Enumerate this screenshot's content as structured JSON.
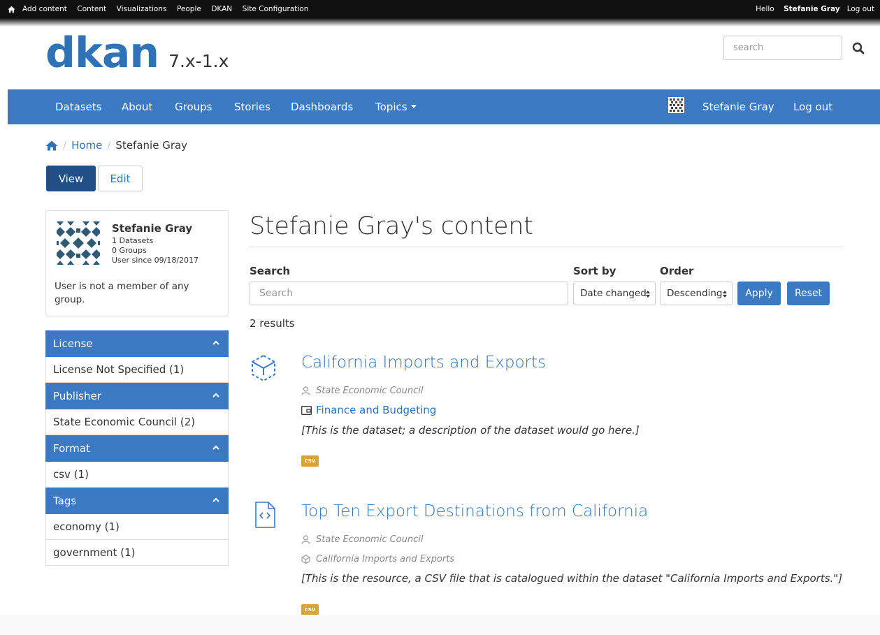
{
  "admin_bar": {
    "links": [
      "Add content",
      "Content",
      "Visualizations",
      "People",
      "DKAN",
      "Site Configuration"
    ],
    "hello": "Hello",
    "user": "Stefanie Gray",
    "logout": "Log out"
  },
  "header": {
    "logo": "dkan",
    "version": "7.x-1.x",
    "search_placeholder": "search"
  },
  "nav": {
    "items": [
      "Datasets",
      "About",
      "Groups",
      "Stories",
      "Dashboards",
      "Topics"
    ],
    "user": "Stefanie Gray",
    "logout": "Log out"
  },
  "breadcrumb": {
    "home": "Home",
    "current": "Stefanie Gray"
  },
  "tabs": {
    "view": "View",
    "edit": "Edit"
  },
  "profile": {
    "name": "Stefanie Gray",
    "datasets": "1 Datasets",
    "groups": "0 Groups",
    "since": "User since 09/18/2017",
    "note": "User is not a member of any group."
  },
  "facets": [
    {
      "title": "License",
      "items": [
        "License Not Specified (1)"
      ]
    },
    {
      "title": "Publisher",
      "items": [
        "State Economic Council (2)"
      ]
    },
    {
      "title": "Format",
      "items": [
        "csv (1)"
      ]
    },
    {
      "title": "Tags",
      "items": [
        "economy (1)",
        "government (1)"
      ]
    }
  ],
  "content": {
    "title": "Stefanie Gray's content",
    "search_label": "Search",
    "search_placeholder": "Search",
    "sort_label": "Sort by",
    "sort_value": "Date changed",
    "order_label": "Order",
    "order_value": "Descending",
    "apply": "Apply",
    "reset": "Reset",
    "results_count": "2 results"
  },
  "results": [
    {
      "title": "California Imports and Exports",
      "publisher": "State Economic Council",
      "topic": "Finance and Budgeting",
      "description": "[This is the dataset; a description of the dataset would go here.]",
      "format": "csv"
    },
    {
      "title": "Top Ten Export Destinations from California",
      "publisher": "State Economic Council",
      "parent": "California Imports and Exports",
      "description": "[This is the resource, a CSV file that is catalogued within the dataset \"California Imports and Exports.\"]",
      "format": "csv"
    }
  ],
  "colors": {
    "brand_blue": "#3b7ac3",
    "link_blue": "#2f72b7",
    "dark_blue": "#1f4f86",
    "badge_gold": "#d6a432",
    "admin_bar": "#111111"
  }
}
